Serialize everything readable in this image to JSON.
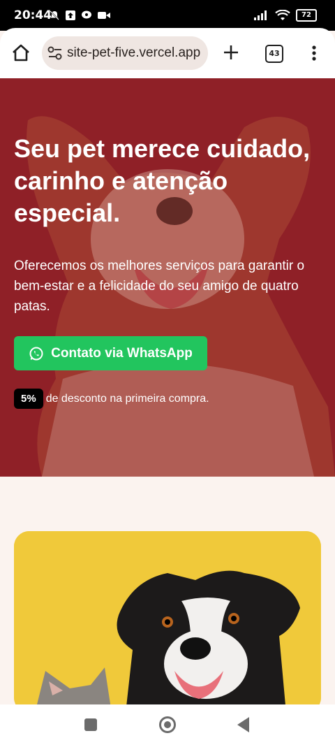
{
  "status_bar": {
    "time": "20:44",
    "battery": "72"
  },
  "browser": {
    "url": "site-pet-five.vercel.app",
    "tab_count": "43"
  },
  "hero": {
    "title": "Seu pet merece cuidado, carinho e atenção especial.",
    "description": "Oferecemos os melhores serviços para garantir o bem-estar e a felicidade do seu amigo de quatro patas.",
    "whatsapp_button": "Contato via WhatsApp",
    "discount_badge": "5%",
    "discount_text": "de desconto na primeira compra."
  },
  "colors": {
    "hero_overlay": "#8f2027",
    "whatsapp_green": "#22c55e",
    "card_yellow": "#f0c93a",
    "page_bg": "#fbf3ef"
  }
}
